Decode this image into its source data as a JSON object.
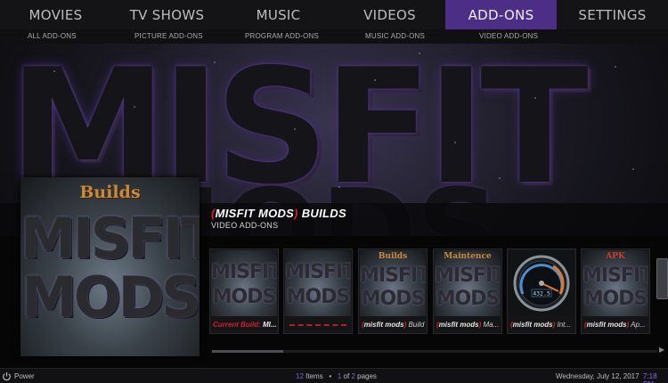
{
  "nav": {
    "items": [
      "MOVIES",
      "TV SHOWS",
      "MUSIC",
      "VIDEOS",
      "ADD-ONS",
      "SETTINGS"
    ],
    "active": "ADD-ONS"
  },
  "subnav": {
    "items": [
      "ALL ADD-ONS",
      "PICTURE ADD-ONS",
      "PROGRAM ADD-ONS",
      "MUSIC ADD-ONS",
      "VIDEO ADD-ONS"
    ]
  },
  "fanart": {
    "text_top": "MISFIT",
    "text_bottom": "MODS"
  },
  "selected": {
    "title_brand": "MISFIT MODS",
    "title_rest": " BUILDS",
    "subtitle": "VIDEO ADD-ONS"
  },
  "poster": {
    "top": "Builds",
    "line1": "MISFIT",
    "line2": "MODS"
  },
  "thumbs": [
    {
      "art": "misfit-mods",
      "label_red": "Current Build:",
      "label_rest": " MI..."
    },
    {
      "art": "misfit-mods",
      "label_red": "",
      "label_rest": ""
    },
    {
      "art": "builds",
      "header": "Builds",
      "label_brand": "misfit mods",
      "label_rest": " Build"
    },
    {
      "art": "maintenance",
      "header": "Maintence",
      "label_brand": "misfit mods",
      "label_rest": " Ma..."
    },
    {
      "art": "speed-gauge",
      "gauge_value": "432.5",
      "label_brand": "misfit mods",
      "label_rest": " Int..."
    },
    {
      "art": "apk",
      "header": "APK",
      "label_brand": "misfit mods",
      "label_rest": " Ap..."
    }
  ],
  "footer": {
    "power": "Power",
    "items_count": "12",
    "items_label": "Items",
    "page_current": "1",
    "page_of": "of",
    "page_total": "2",
    "pages_label": "pages",
    "date": "Wednesday, July 12, 2017",
    "time": "7:18 PM"
  },
  "scroll": {
    "position": 0.16
  },
  "colors": {
    "accent": "#4c2e86",
    "brand_red": "#d21f2a",
    "number": "#7c66c4"
  },
  "icons": {
    "power": "power-icon"
  }
}
